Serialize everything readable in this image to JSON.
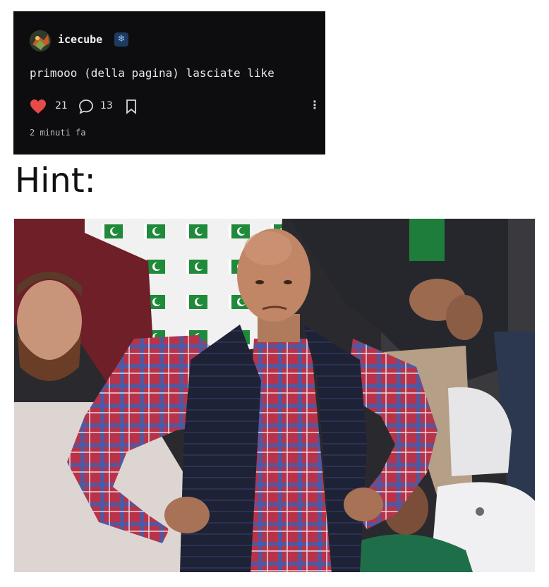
{
  "post": {
    "username": "icecube",
    "badge_icon": "snowflake-icon",
    "text": "primooo (della pagina) lasciate like",
    "likes": "21",
    "comments": "13",
    "time": "2 minuti fa",
    "heart_color": "#e84a4a"
  },
  "hint": {
    "label": "Hint:"
  }
}
